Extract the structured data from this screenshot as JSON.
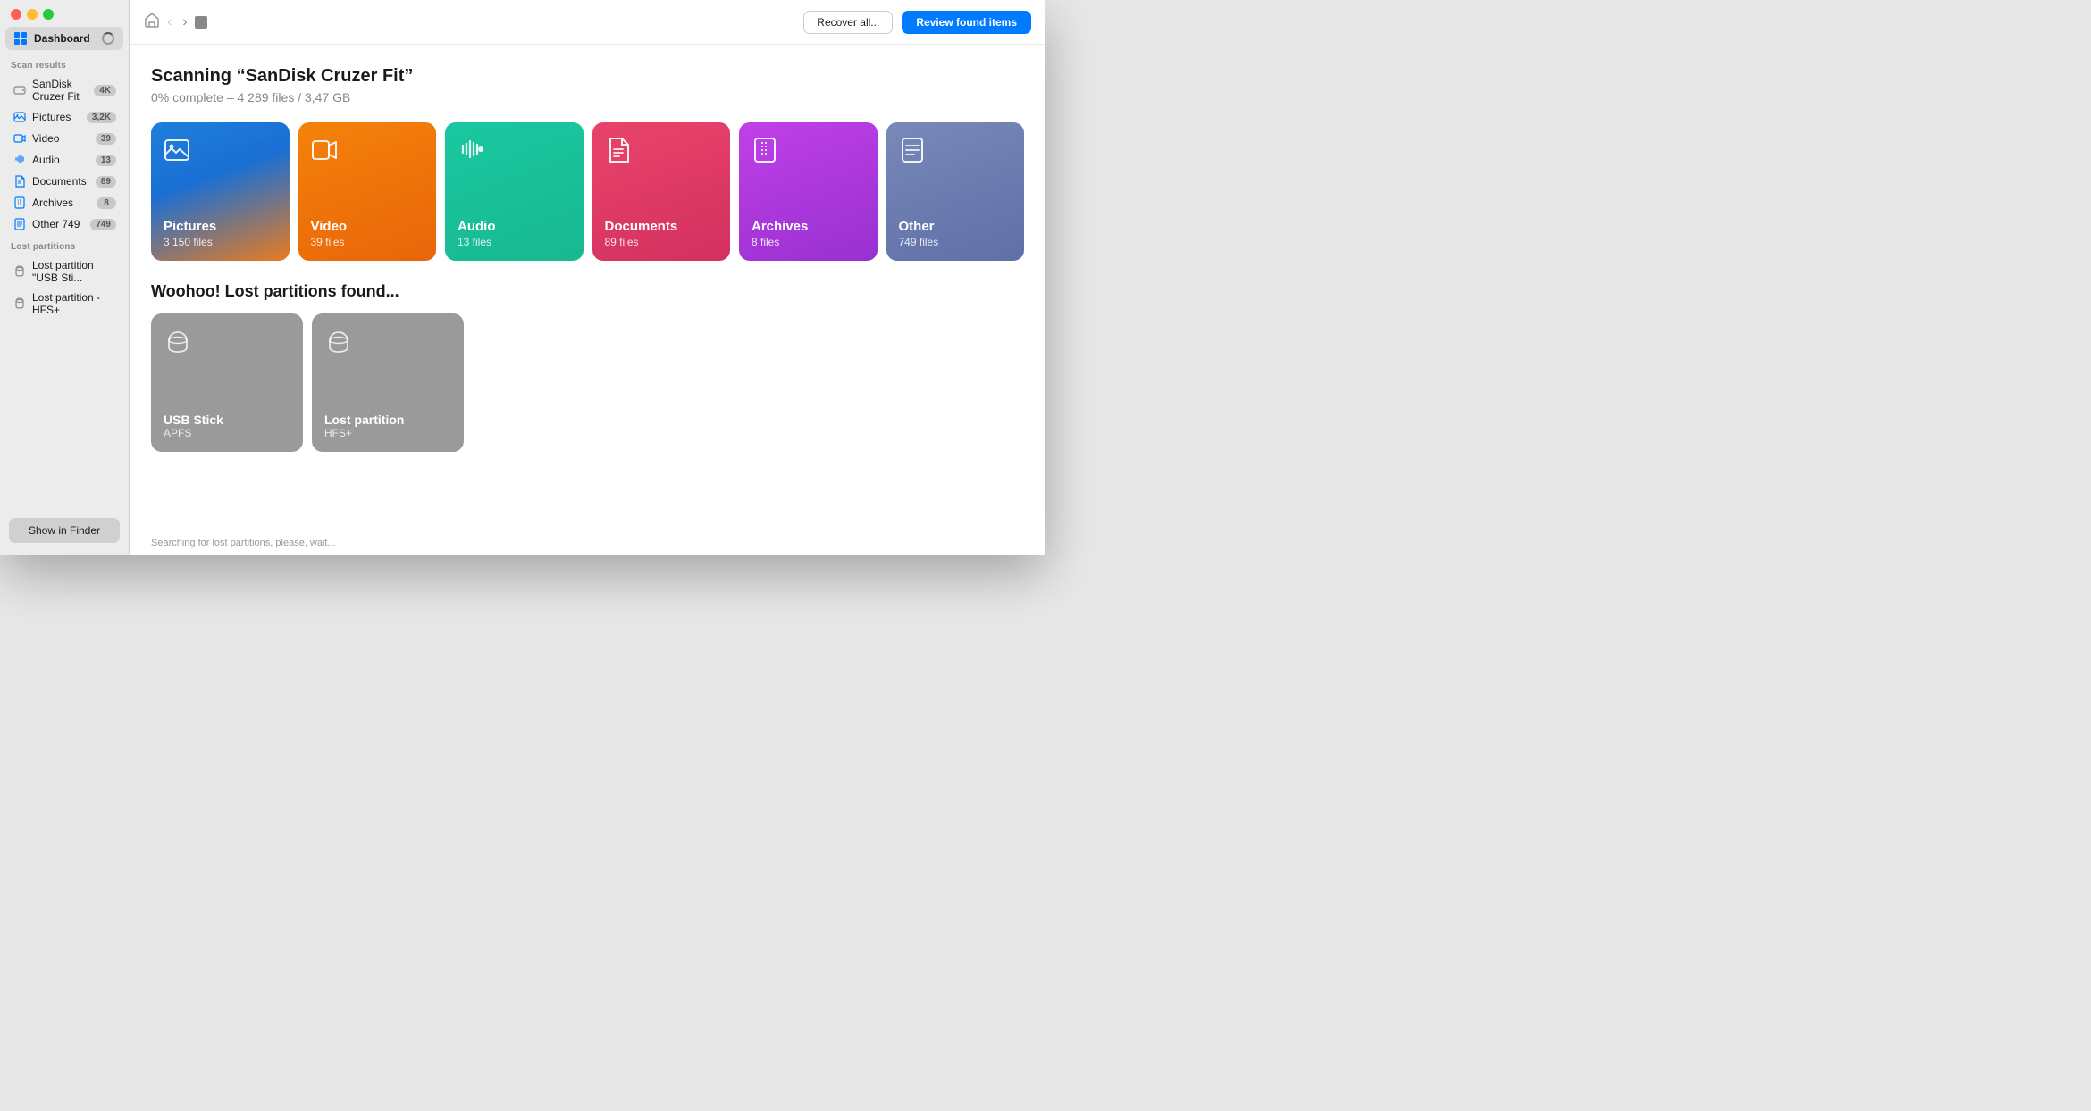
{
  "app": {
    "title": "Dashboard"
  },
  "topbar": {
    "recover_label": "Recover all...",
    "review_label": "Review found items"
  },
  "scan": {
    "title": "Scanning “SanDisk Cruzer Fit”",
    "subtitle": "0% complete – 4 289 files / 3,47 GB"
  },
  "file_cards": [
    {
      "name": "Pictures",
      "count": "3 150 files",
      "type": "pictures"
    },
    {
      "name": "Video",
      "count": "39 files",
      "type": "video"
    },
    {
      "name": "Audio",
      "count": "13 files",
      "type": "audio"
    },
    {
      "name": "Documents",
      "count": "89 files",
      "type": "documents"
    },
    {
      "name": "Archives",
      "count": "8 files",
      "type": "archives"
    },
    {
      "name": "Other",
      "count": "749 files",
      "type": "other"
    }
  ],
  "lost_partitions": {
    "title": "Woohoo! Lost partitions found...",
    "partitions": [
      {
        "name": "USB Stick",
        "fstype": "APFS"
      },
      {
        "name": "Lost partition",
        "fstype": "HFS+"
      }
    ]
  },
  "sidebar": {
    "dashboard_label": "Dashboard",
    "scan_results_label": "Scan results",
    "scan_items": [
      {
        "label": "SanDisk Cruzer Fit",
        "badge": "4K",
        "icon": "drive"
      },
      {
        "label": "Pictures",
        "badge": "3,2K",
        "icon": "picture"
      },
      {
        "label": "Video",
        "badge": "39",
        "icon": "video"
      },
      {
        "label": "Audio",
        "badge": "13",
        "icon": "audio"
      },
      {
        "label": "Documents",
        "badge": "89",
        "icon": "document"
      },
      {
        "label": "Archives",
        "badge": "8",
        "icon": "archive"
      },
      {
        "label": "Other 749",
        "badge": "749",
        "icon": "other"
      }
    ],
    "lost_partitions_label": "Lost partitions",
    "partition_items": [
      {
        "label": "Lost partition “USB Sti...",
        "icon": "drive"
      },
      {
        "label": "Lost partition - HFS+",
        "icon": "drive"
      }
    ],
    "show_finder_label": "Show in Finder"
  },
  "status": {
    "text": "Searching for lost partitions, please, wait..."
  }
}
